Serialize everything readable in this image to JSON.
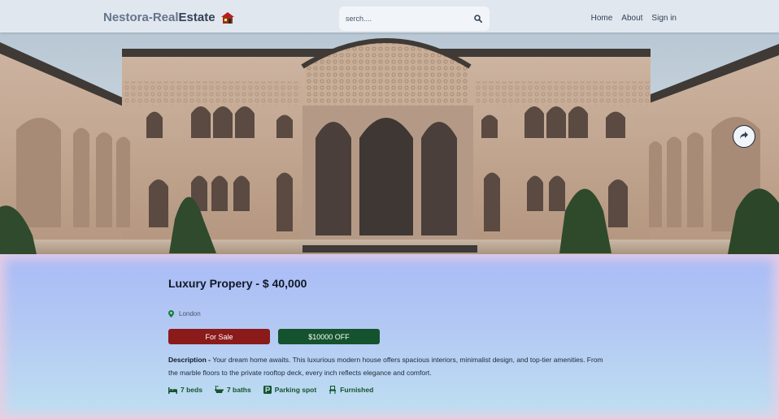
{
  "header": {
    "logo_part1": "Nestora-Real",
    "logo_part2": "Estate",
    "logo_icon": "house-icon",
    "search_placeholder": "serch....",
    "search_icon": "search-icon",
    "nav": [
      "Home",
      "About",
      "Sign in"
    ]
  },
  "hero": {
    "share_icon": "share-arrow-icon"
  },
  "listing": {
    "title": "Luxury Propery - $ 40,000",
    "location": "London",
    "location_icon": "map-pin-icon",
    "sale_label": "For Sale",
    "discount_label": "$10000 OFF",
    "description_label": "Description - ",
    "description_text": "Your dream home awaits. This luxurious modern house offers spacious interiors, minimalist design, and top-tier amenities. From the marble floors to the private rooftop deck, every inch reflects elegance and comfort.",
    "features": [
      {
        "icon": "bed-icon",
        "label": "7 beds"
      },
      {
        "icon": "bath-icon",
        "label": "7 baths"
      },
      {
        "icon": "parking-icon",
        "label": "Parking spot"
      },
      {
        "icon": "chair-icon",
        "label": "Furnished"
      }
    ]
  },
  "colors": {
    "sale": "#8b1a1a",
    "discount": "#14532d",
    "header_bg": "#e1e7ef"
  }
}
